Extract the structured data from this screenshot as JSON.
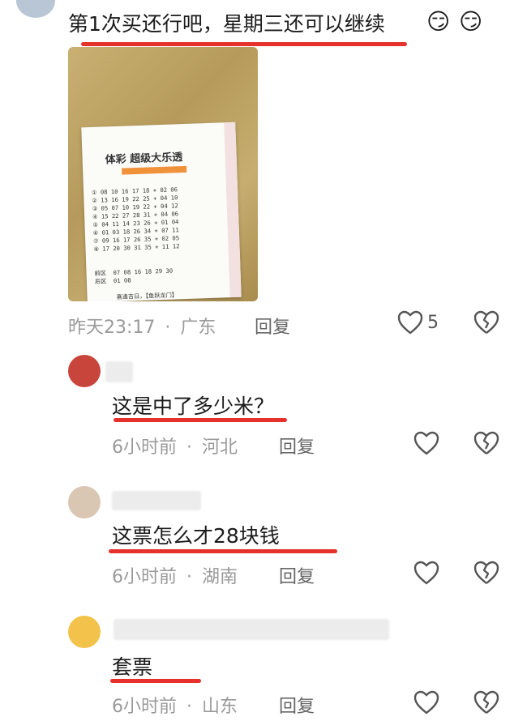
{
  "top_comment": {
    "text": "第1次买还行吧，星期三还可以继续",
    "emoji": [
      "😏",
      "😏"
    ],
    "time": "昨天23:17",
    "location": "广东",
    "reply_label": "回复",
    "like_count": "5",
    "ticket": {
      "title": "体彩 超级大乐透",
      "numbers": "① 08 10 16 17 18 + 02 06\n② 13 16 19 22 25 + 04 10\n③ 05 07 10 19 22 + 04 12\n④ 15 22 27 28 31 + 04 06\n⑤ 04 11 14 23 26 + 01 04\n⑥ 01 03 18 26 34 + 07 11\n⑦ 09 16 17 26 35 + 02 05\n⑧ 17 20 30 31 35 + 11 12",
      "footer": "前区  07 08 16 18 29 30\n后区  01 08\n\n      喜逢吉日，【鱼跃龙门】"
    }
  },
  "replies": [
    {
      "text": "这是中了多少米？",
      "time": "6小时前",
      "location": "河北",
      "reply_label": "回复"
    },
    {
      "text": "这票怎么才28块钱",
      "time": "6小时前",
      "location": "湖南",
      "reply_label": "回复"
    },
    {
      "text": "套票",
      "time": "6小时前",
      "location": "山东",
      "reply_label": "回复"
    }
  ],
  "colors": {
    "underline": "#e5302b",
    "meta": "#9a9a9a"
  }
}
